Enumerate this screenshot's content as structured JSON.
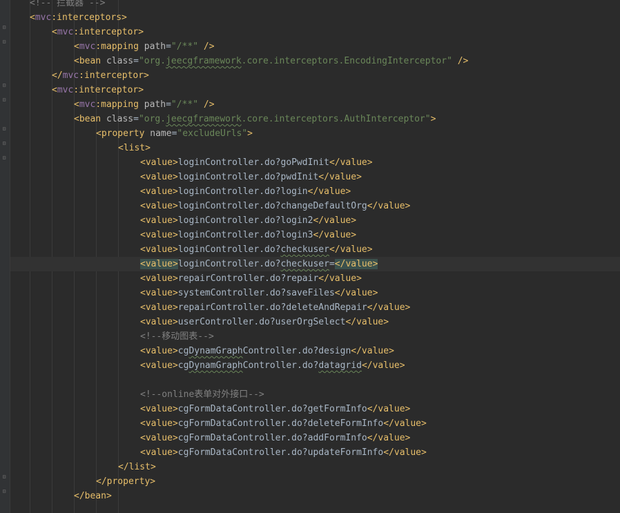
{
  "lines": [
    {
      "indent": 1,
      "parts": [
        [
          "cmt",
          "<!-- 拦截器 -->"
        ]
      ]
    },
    {
      "indent": 1,
      "parts": [
        [
          "tag",
          "<"
        ],
        [
          "ns",
          "mvc"
        ],
        [
          "tag",
          ":interceptors>"
        ]
      ]
    },
    {
      "indent": 2,
      "parts": [
        [
          "tag",
          "<"
        ],
        [
          "ns",
          "mvc"
        ],
        [
          "tag",
          ":interceptor>"
        ]
      ]
    },
    {
      "indent": 3,
      "parts": [
        [
          "tag",
          "<"
        ],
        [
          "ns",
          "mvc"
        ],
        [
          "tag",
          ":mapping "
        ],
        [
          "attr",
          "path"
        ],
        [
          "txt",
          "="
        ],
        [
          "val",
          "\"/**\""
        ],
        [
          "tag",
          " />"
        ]
      ]
    },
    {
      "indent": 3,
      "parts": [
        [
          "tag",
          "<bean "
        ],
        [
          "attr",
          "class"
        ],
        [
          "txt",
          "="
        ],
        [
          "val",
          "\"org."
        ],
        [
          "valw",
          "jeecgframework"
        ],
        [
          "val",
          ".core.interceptors.EncodingInterceptor\""
        ],
        [
          "tag",
          " />"
        ]
      ]
    },
    {
      "indent": 2,
      "parts": [
        [
          "tag",
          "</"
        ],
        [
          "ns",
          "mvc"
        ],
        [
          "tag",
          ":interceptor>"
        ]
      ]
    },
    {
      "indent": 2,
      "parts": [
        [
          "tag",
          "<"
        ],
        [
          "ns",
          "mvc"
        ],
        [
          "tag",
          ":interceptor>"
        ]
      ]
    },
    {
      "indent": 3,
      "parts": [
        [
          "tag",
          "<"
        ],
        [
          "ns",
          "mvc"
        ],
        [
          "tag",
          ":mapping "
        ],
        [
          "attr",
          "path"
        ],
        [
          "txt",
          "="
        ],
        [
          "val",
          "\"/**\""
        ],
        [
          "tag",
          " />"
        ]
      ]
    },
    {
      "indent": 3,
      "parts": [
        [
          "tag",
          "<bean "
        ],
        [
          "attr",
          "class"
        ],
        [
          "txt",
          "="
        ],
        [
          "val",
          "\"org."
        ],
        [
          "valw",
          "jeecgframework"
        ],
        [
          "val",
          ".core.interceptors.AuthInterceptor\""
        ],
        [
          "tag",
          ">"
        ]
      ]
    },
    {
      "indent": 4,
      "parts": [
        [
          "tag",
          "<property "
        ],
        [
          "attr",
          "name"
        ],
        [
          "txt",
          "="
        ],
        [
          "val",
          "\"excludeUrls\""
        ],
        [
          "tag",
          ">"
        ]
      ]
    },
    {
      "indent": 5,
      "parts": [
        [
          "tag",
          "<list>"
        ]
      ]
    },
    {
      "indent": 6,
      "parts": [
        [
          "tag",
          "<value>"
        ],
        [
          "txt",
          "loginController.do?goPwdInit"
        ],
        [
          "tag",
          "</value>"
        ]
      ]
    },
    {
      "indent": 6,
      "parts": [
        [
          "tag",
          "<value>"
        ],
        [
          "txt",
          "loginController.do?pwdInit"
        ],
        [
          "tag",
          "</value>"
        ]
      ]
    },
    {
      "indent": 6,
      "parts": [
        [
          "tag",
          "<value>"
        ],
        [
          "txt",
          "loginController.do?login"
        ],
        [
          "tag",
          "</value>"
        ]
      ]
    },
    {
      "indent": 6,
      "parts": [
        [
          "tag",
          "<value>"
        ],
        [
          "txt",
          "loginController.do?changeDefaultOrg"
        ],
        [
          "tag",
          "</value>"
        ]
      ]
    },
    {
      "indent": 6,
      "parts": [
        [
          "tag",
          "<value>"
        ],
        [
          "txt",
          "loginController.do?login2"
        ],
        [
          "tag",
          "</value>"
        ]
      ]
    },
    {
      "indent": 6,
      "parts": [
        [
          "tag",
          "<value>"
        ],
        [
          "txt",
          "loginController.do?login3"
        ],
        [
          "tag",
          "</value>"
        ]
      ]
    },
    {
      "indent": 6,
      "parts": [
        [
          "tag",
          "<value>"
        ],
        [
          "txt",
          "loginController.do?"
        ],
        [
          "txtw",
          "checkuser"
        ],
        [
          "tag",
          "</value>"
        ]
      ]
    },
    {
      "indent": 6,
      "current": true,
      "parts": [
        [
          "taghl",
          "<value>"
        ],
        [
          "txt",
          "loginController.do?"
        ],
        [
          "txtw",
          "checkuser"
        ],
        [
          "txt",
          "="
        ],
        [
          "taghl",
          "</value>"
        ]
      ]
    },
    {
      "indent": 6,
      "parts": [
        [
          "tag",
          "<value>"
        ],
        [
          "txt",
          "repairController.do?repair"
        ],
        [
          "tag",
          "</value>"
        ]
      ]
    },
    {
      "indent": 6,
      "parts": [
        [
          "tag",
          "<value>"
        ],
        [
          "txt",
          "systemController.do?saveFiles"
        ],
        [
          "tag",
          "</value>"
        ]
      ]
    },
    {
      "indent": 6,
      "parts": [
        [
          "tag",
          "<value>"
        ],
        [
          "txt",
          "repairController.do?deleteAndRepair"
        ],
        [
          "tag",
          "</value>"
        ]
      ]
    },
    {
      "indent": 6,
      "parts": [
        [
          "tag",
          "<value>"
        ],
        [
          "txt",
          "userController.do?userOrgSelect"
        ],
        [
          "tag",
          "</value>"
        ]
      ]
    },
    {
      "indent": 6,
      "parts": [
        [
          "cmt",
          "<!--移动图表-->"
        ]
      ]
    },
    {
      "indent": 6,
      "parts": [
        [
          "tag",
          "<value>"
        ],
        [
          "txt",
          "cg"
        ],
        [
          "txtw",
          "DynamGraph"
        ],
        [
          "txt",
          "Controller.do?design"
        ],
        [
          "tag",
          "</value>"
        ]
      ]
    },
    {
      "indent": 6,
      "parts": [
        [
          "tag",
          "<value>"
        ],
        [
          "txt",
          "cg"
        ],
        [
          "txtw",
          "DynamGraph"
        ],
        [
          "txt",
          "Controller.do?"
        ],
        [
          "txtw",
          "datagrid"
        ],
        [
          "tag",
          "</value>"
        ]
      ]
    },
    {
      "indent": 0,
      "parts": []
    },
    {
      "indent": 6,
      "parts": [
        [
          "cmt",
          "<!--online表单对外接口-->"
        ]
      ]
    },
    {
      "indent": 6,
      "parts": [
        [
          "tag",
          "<value>"
        ],
        [
          "txt",
          "cgFormDataController.do?getFormInfo"
        ],
        [
          "tag",
          "</value>"
        ]
      ]
    },
    {
      "indent": 6,
      "parts": [
        [
          "tag",
          "<value>"
        ],
        [
          "txt",
          "cgFormDataController.do?deleteFormInfo"
        ],
        [
          "tag",
          "</value>"
        ]
      ]
    },
    {
      "indent": 6,
      "parts": [
        [
          "tag",
          "<value>"
        ],
        [
          "txt",
          "cgFormDataController.do?addFormInfo"
        ],
        [
          "tag",
          "</value>"
        ]
      ]
    },
    {
      "indent": 6,
      "parts": [
        [
          "tag",
          "<value>"
        ],
        [
          "txt",
          "cgFormDataController.do?updateFormInfo"
        ],
        [
          "tag",
          "</value>"
        ]
      ]
    },
    {
      "indent": 5,
      "parts": [
        [
          "tag",
          "</list>"
        ]
      ]
    },
    {
      "indent": 4,
      "parts": [
        [
          "tag",
          "</property>"
        ]
      ]
    },
    {
      "indent": 3,
      "parts": [
        [
          "tag",
          "</bean>"
        ]
      ]
    }
  ]
}
